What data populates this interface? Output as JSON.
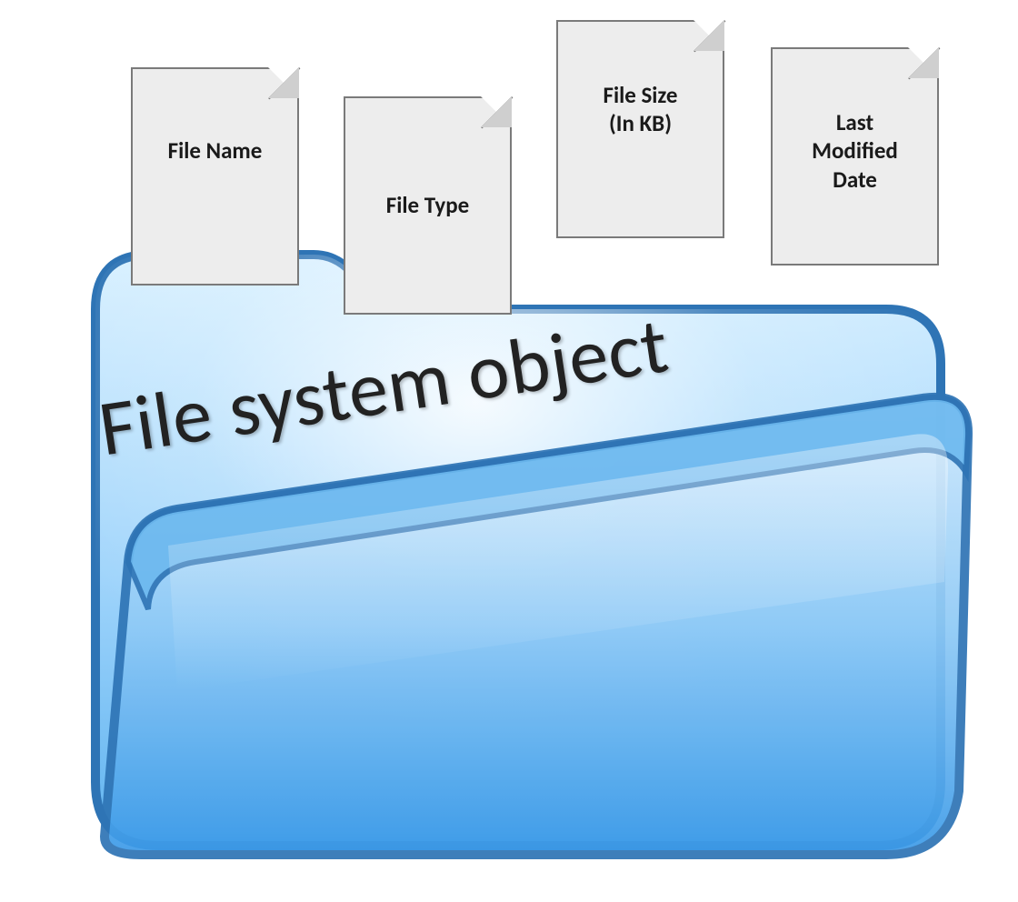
{
  "documents": {
    "file_name": {
      "label": "File Name"
    },
    "file_type": {
      "label": "File Type"
    },
    "file_size": {
      "label": "File Size\n(In KB)"
    },
    "last_modified": {
      "label": "Last\nModified\nDate"
    }
  },
  "folder": {
    "title": "File system object"
  },
  "colors": {
    "doc_fill": "#ededed",
    "doc_border": "#7a7a7a",
    "folder_stroke": "#2e74b5",
    "folder_back_light": "#bfe3ff",
    "folder_back_dark": "#5fb3f5",
    "folder_front_light": "#b8dcfb",
    "folder_front_dark": "#3b9ae8"
  }
}
